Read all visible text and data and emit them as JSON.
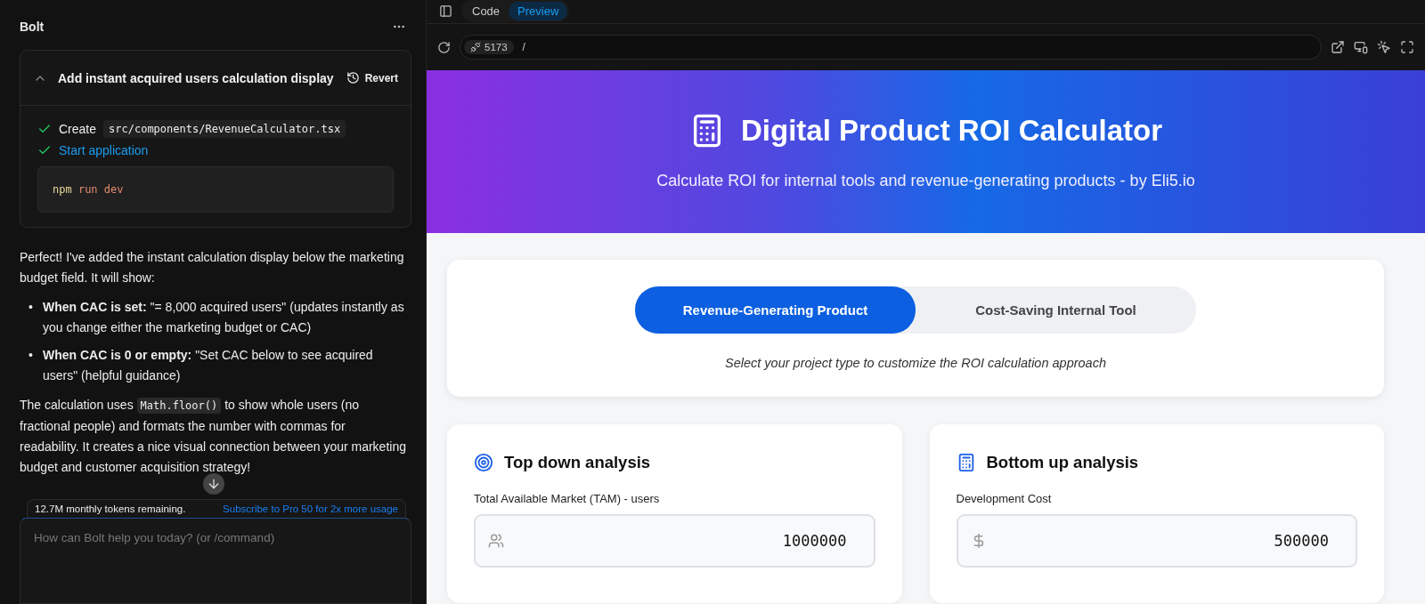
{
  "sidebar": {
    "title": "Bolt",
    "action_card": {
      "title": "Add instant acquired users calculation display",
      "expanded": true,
      "revert_label": "Revert",
      "steps": [
        {
          "kind": "file",
          "label": "Create",
          "file": "src/components/RevenueCalculator.tsx",
          "done": true
        },
        {
          "kind": "command",
          "label": "Start application",
          "done": true
        }
      ],
      "command": "npm run dev"
    },
    "message": {
      "intro": "Perfect! I've added the instant calculation display below the marketing budget field. It will show:",
      "bullet_marker": "•",
      "bullets": [
        "**When CAC is set:** \"= 8,000 acquired users\" (updates instantly as you change either the marketing budget or CAC)",
        "**When CAC is 0 or empty:** \"Set CAC below to see acquired users\" (helpful guidance)"
      ],
      "closing": {
        "before": "The calculation uses",
        "code": "Math.floor()",
        "after": "to show whole users (no fractional people) and formats the number with commas for readability. It creates a nice visual connection between your marketing budget and customer acquisition strategy!"
      }
    },
    "tokens": {
      "remaining": "12.7M monthly tokens remaining.",
      "upgrade_link": "Subscribe to Pro 50 for 2x more usage"
    },
    "prompt": {
      "placeholder": "How can Bolt help you today? (or /command)"
    }
  },
  "toolbar": {
    "tabs": [
      {
        "label": "Code",
        "selected": false
      },
      {
        "label": "Preview",
        "selected": true
      }
    ]
  },
  "address_bar": {
    "port": "5173",
    "path": "/"
  },
  "preview": {
    "header": {
      "title": "Digital Product ROI Calculator",
      "subtitle": "Calculate ROI for internal tools and revenue-generating products - by Eli5.io"
    },
    "project_type": {
      "options": [
        {
          "label": "Revenue-Generating Product",
          "selected": true
        },
        {
          "label": "Cost-Saving Internal Tool",
          "selected": false
        }
      ],
      "caption": "Select your project type to customize the ROI calculation approach"
    },
    "cards": [
      {
        "kind": "target",
        "title": "Top down analysis",
        "field": {
          "kind": "users",
          "label": "Total Available Market (TAM) - users",
          "value": "1000000"
        }
      },
      {
        "kind": "calculator",
        "title": "Bottom up analysis",
        "field": {
          "kind": "dollar",
          "label": "Development Cost",
          "value": "500000"
        }
      }
    ]
  }
}
